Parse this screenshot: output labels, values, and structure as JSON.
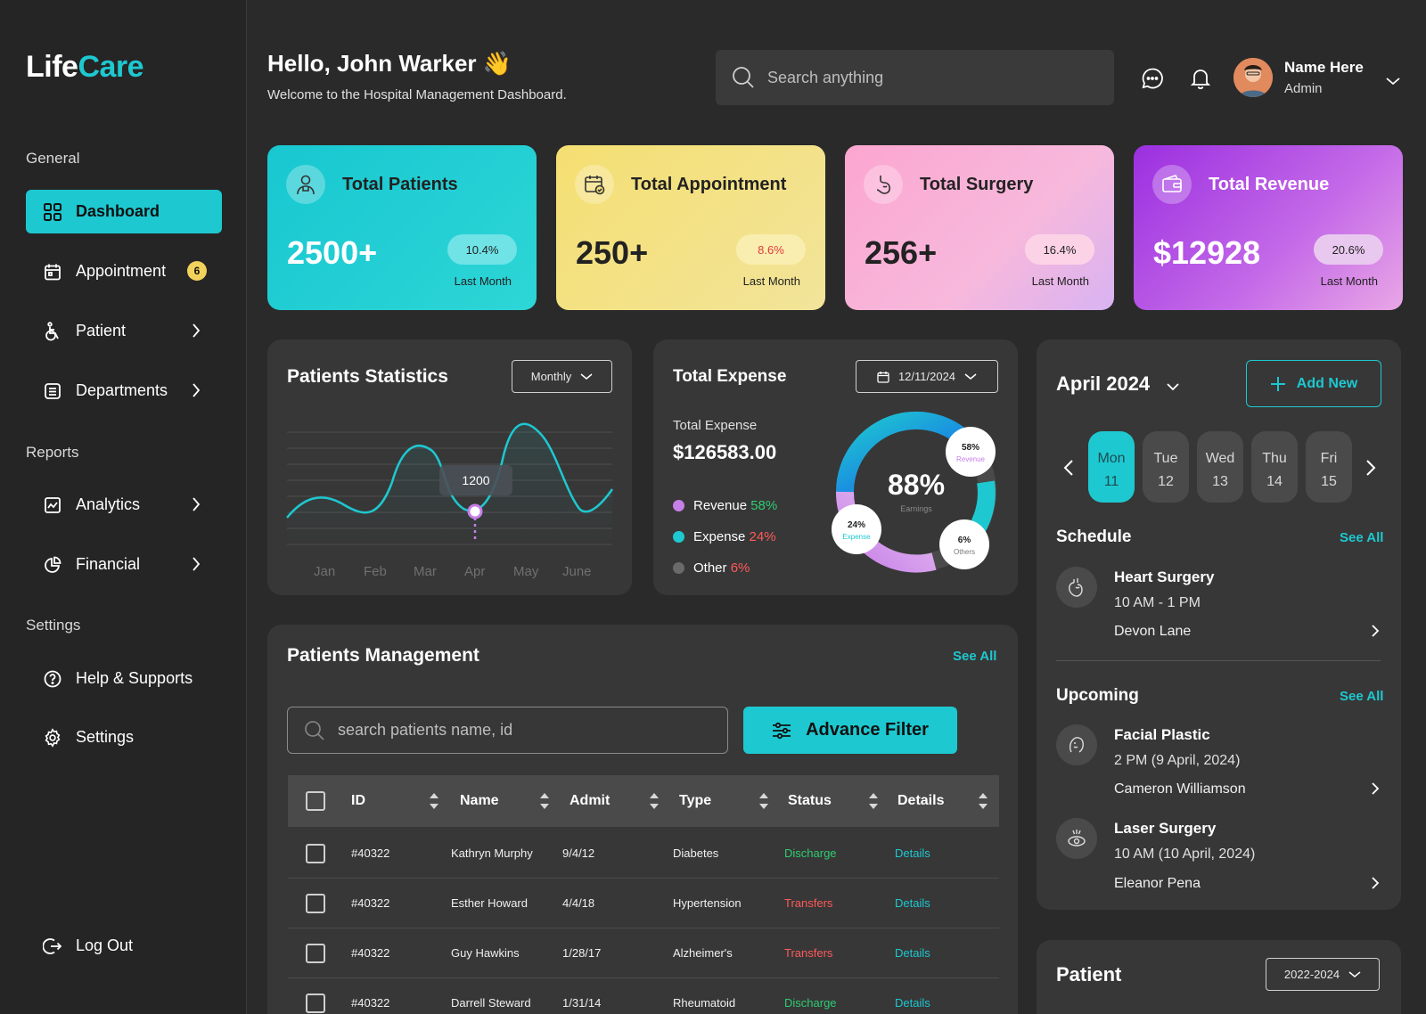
{
  "brand": {
    "part1": "Life",
    "part2": "Care"
  },
  "sidebar": {
    "general_label": "General",
    "reports_label": "Reports",
    "settings_label": "Settings",
    "items": {
      "dashboard": "Dashboard",
      "appointment": "Appointment",
      "appointment_count": "6",
      "patient": "Patient",
      "departments": "Departments",
      "analytics": "Analytics",
      "financial": "Financial",
      "help": "Help & Supports",
      "settings": "Settings",
      "logout": "Log Out"
    }
  },
  "header": {
    "greeting": "Hello, John Warker",
    "wave": "👋",
    "subtitle": "Welcome to the Hospital Management Dashboard.",
    "search_placeholder": "Search anything",
    "user_name": "Name Here",
    "user_role": "Admin"
  },
  "stats": [
    {
      "title": "Total Patients",
      "value": "2500+",
      "change": "10.4%",
      "period": "Last Month",
      "change_color": "#1a1a1a"
    },
    {
      "title": "Total Appointment",
      "value": "250+",
      "change": "8.6%",
      "period": "Last Month",
      "change_color": "#e03b3b"
    },
    {
      "title": "Total Surgery",
      "value": "256+",
      "change": "16.4%",
      "period": "Last Month",
      "change_color": "#1a1a1a"
    },
    {
      "title": "Total Revenue",
      "value": "$12928",
      "change": "20.6%",
      "period": "Last Month",
      "change_color": "#1a1a1a"
    }
  ],
  "patients_statistics": {
    "title": "Patients Statistics",
    "filter": "Monthly",
    "tooltip": "1200"
  },
  "chart_data": [
    {
      "type": "line",
      "x": [
        "Jan",
        "Feb",
        "Mar",
        "Apr",
        "May",
        "June"
      ],
      "highlight": {
        "x": "Apr",
        "label": "1200"
      }
    },
    {
      "type": "pie",
      "title": "Total Expense",
      "center_value": "88%",
      "center_label": "Earnings",
      "slices": [
        {
          "name": "Revenue",
          "value": 58
        },
        {
          "name": "Expense",
          "value": 24
        },
        {
          "name": "Others",
          "value": 6
        }
      ]
    }
  ],
  "total_expense": {
    "title": "Total Expense",
    "date": "12/11/2024",
    "label": "Total Expense",
    "amount": "$126583.00",
    "legend": [
      {
        "name": "Revenue",
        "pct": "58%",
        "color": "#c77fe8",
        "pct_color": "#2ecc71"
      },
      {
        "name": "Expense",
        "pct": "24%",
        "color": "#1ec8d0",
        "pct_color": "#ff5a5a"
      },
      {
        "name": "Other",
        "pct": "6%",
        "color": "#6a6a6a",
        "pct_color": "#ff5a5a"
      }
    ],
    "donut": {
      "center": "88%",
      "center_label": "Earnings",
      "rev_pct": "58%",
      "rev_label": "Revenue",
      "exp_pct": "24%",
      "exp_label": "Expense",
      "oth_pct": "6%",
      "oth_label": "Others"
    }
  },
  "patients_management": {
    "title": "Patients Management",
    "see_all": "See All",
    "search_placeholder": "search patients name, id",
    "filter_button": "Advance Filter",
    "columns": [
      "ID",
      "Name",
      "Admit",
      "Type",
      "Status",
      "Details"
    ],
    "rows": [
      {
        "id": "#40322",
        "name": "Kathryn Murphy",
        "admit": "9/4/12",
        "type": "Diabetes",
        "status": "Discharge",
        "details": "Details"
      },
      {
        "id": "#40322",
        "name": "Esther Howard",
        "admit": "4/4/18",
        "type": "Hypertension",
        "status": "Transfers",
        "details": "Details"
      },
      {
        "id": "#40322",
        "name": "Guy Hawkins",
        "admit": "1/28/17",
        "type": "Alzheimer's",
        "status": "Transfers",
        "details": "Details"
      },
      {
        "id": "#40322",
        "name": "Darrell Steward",
        "admit": "1/31/14",
        "type": "Rheumatoid",
        "status": "Discharge",
        "details": "Details"
      }
    ]
  },
  "calendar": {
    "month": "April 2024",
    "add_new": "Add New",
    "days": [
      {
        "name": "Mon",
        "num": "11"
      },
      {
        "name": "Tue",
        "num": "12"
      },
      {
        "name": "Wed",
        "num": "13"
      },
      {
        "name": "Thu",
        "num": "14"
      },
      {
        "name": "Fri",
        "num": "15"
      }
    ],
    "schedule_title": "Schedule",
    "upcoming_title": "Upcoming",
    "see_all": "See All",
    "schedule": [
      {
        "title": "Heart Surgery",
        "time": "10 AM - 1 PM",
        "person": "Devon Lane"
      }
    ],
    "upcoming": [
      {
        "title": "Facial Plastic",
        "time": "2 PM (9 April, 2024)",
        "person": "Cameron Williamson"
      },
      {
        "title": "Laser Surgery",
        "time": "10 AM (10 April, 2024)",
        "person": "Eleanor Pena"
      }
    ]
  },
  "patient_panel": {
    "title": "Patient",
    "range": "2022-2024"
  }
}
